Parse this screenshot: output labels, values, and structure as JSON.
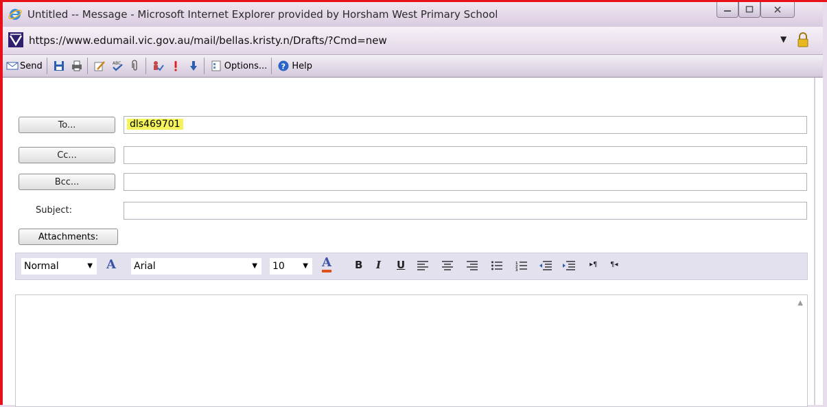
{
  "window": {
    "title": "Untitled -- Message - Microsoft Internet Explorer provided by Horsham West Primary School"
  },
  "address_bar": {
    "url": "https://www.edumail.vic.gov.au/mail/bellas.kristy.n/Drafts/?Cmd=new"
  },
  "toolbar": {
    "send_label": "Send",
    "options_label": "Options...",
    "help_label": "Help"
  },
  "compose": {
    "to_button": "To...",
    "cc_button": "Cc...",
    "bcc_button": "Bcc...",
    "to_value": "dls469701",
    "cc_value": "",
    "bcc_value": "",
    "subject_label": "Subject:",
    "subject_value": "",
    "attachments_button": "Attachments:"
  },
  "format_bar": {
    "style_value": "Normal",
    "font_value": "Arial",
    "size_value": "10"
  },
  "colors": {
    "highlight": "#f4f35a",
    "frame_red": "#e8101a",
    "font_color_underline": "#e0501a"
  }
}
